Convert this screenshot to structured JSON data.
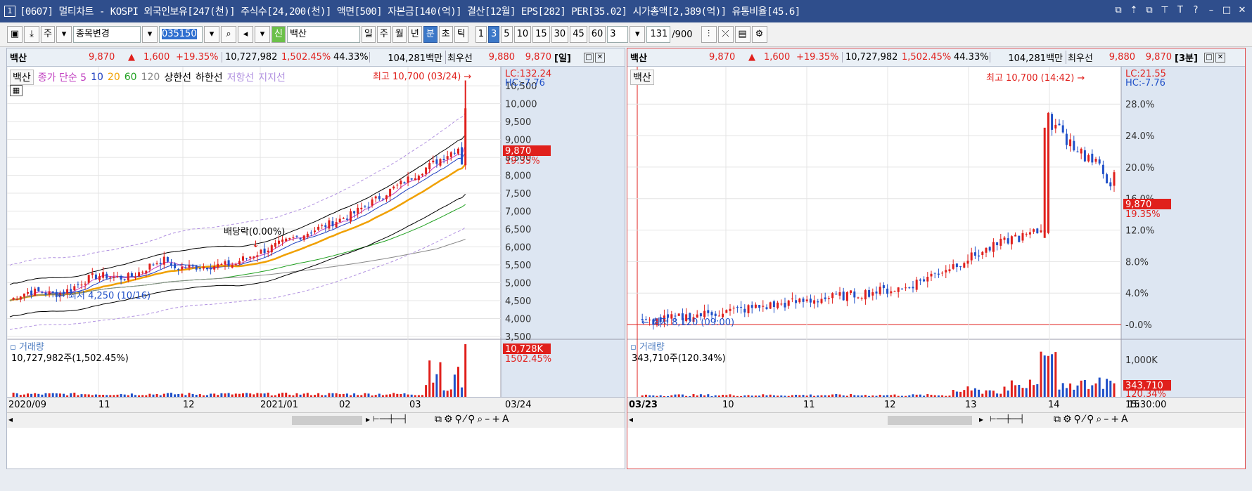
{
  "window": {
    "num": "1",
    "title": "[0607] 멀티차트 - KOSPI 외국인보유[247(천)] 주식수[24,200(천)] 액면[500] 자본금[140(억)] 결산[12월] EPS[282] PER[35.02] 시가총액[2,389(억)] 유통비율[45.6]",
    "controls": [
      "⧉",
      "⇡",
      "⧉",
      "⊤",
      "T",
      "?",
      "–",
      "□",
      "✕"
    ]
  },
  "toolbar": {
    "jong_label": "주",
    "change_label": "종목변경",
    "code": "035150",
    "stock_prefix": "신",
    "stock_name": "백산",
    "periods": [
      "일",
      "주",
      "월",
      "년",
      "분",
      "초",
      "틱"
    ],
    "period_selected": "분",
    "nums": [
      "1",
      "3",
      "5",
      "10",
      "15",
      "30",
      "45",
      "60"
    ],
    "num_selected": "3",
    "count_value": "3",
    "view_count": "131",
    "view_total": "/900"
  },
  "left": {
    "info": {
      "name": "백산",
      "price": "9,870",
      "arrow": "▲",
      "change": "1,600",
      "pct": "+19.35%",
      "volume": "10,727,982",
      "vol_pct": "1,502.45%",
      "ratio": "44.33%",
      "amount": "104,281백만",
      "best_label": "최우선",
      "ask": "9,880",
      "bid": "9,870",
      "period": "[일]"
    },
    "legend": {
      "name": "백산",
      "items": [
        "종가 단순 5",
        "10",
        "20",
        "60",
        "120",
        "상한선",
        "하한선",
        "저항선",
        "지지선"
      ],
      "colors": [
        "#c040c0",
        "#2040c0",
        "#f0a000",
        "#20a020",
        "#888888",
        "#000000",
        "#000000",
        "#b090e0",
        "#b090e0"
      ]
    },
    "y_ticks": [
      "10,500",
      "10,000",
      "9,500",
      "9,000",
      "8,500",
      "8,000",
      "7,500",
      "7,000",
      "6,500",
      "6,000",
      "5,500",
      "5,000",
      "4,500",
      "4,000",
      "3,500"
    ],
    "lc": "LC:132.24",
    "hc": "HC:-7.76",
    "price_tag": "9,870",
    "pct_tag": "19.35%",
    "high_label": "최고 10,700 (03/24)",
    "low_label": "최저 4,250 (10/16)",
    "dividend_label": "배당락(0.00%)",
    "vol_title": "거래량",
    "vol_text": "10,727,982주(1,502.45%)",
    "vol_tag": "10,728K",
    "vol_pct_tag": "1502.45%",
    "x_labels": [
      "2020/09",
      "11",
      "12",
      "2021/01",
      "02",
      "03"
    ],
    "x_end": "03/24"
  },
  "right": {
    "info": {
      "name": "백산",
      "price": "9,870",
      "arrow": "▲",
      "change": "1,600",
      "pct": "+19.35%",
      "volume": "10,727,982",
      "vol_pct": "1,502.45%",
      "ratio": "44.33%",
      "amount": "104,281백만",
      "best_label": "최우선",
      "ask": "9,880",
      "bid": "9,870",
      "period": "[3분]"
    },
    "legend_name": "백산",
    "y_ticks": [
      "28.0%",
      "24.0%",
      "20.0%",
      "16.0%",
      "12.0%",
      "8.0%",
      "4.0%",
      "-0.0%"
    ],
    "lc": "LC:21.55",
    "hc": "HC:-7.76",
    "price_tag": "9,870",
    "pct_tag": "19.35%",
    "high_label": "최고 10,700 (14:42)",
    "low_label": "최저 8,120 (09:00)",
    "vol_title": "거래량",
    "vol_text": "343,710주(120.34%)",
    "vol_tick": "1,000K",
    "vol_tag": "343,710",
    "vol_pct_tag": "120.34%",
    "x_labels": [
      "03/23",
      "10",
      "11",
      "12",
      "13",
      "14",
      "15"
    ],
    "x_end": "15:30:00"
  },
  "colors": {
    "up": "#e0201c",
    "down": "#2050c8",
    "accent": "#3c78c8"
  },
  "chart_data": [
    {
      "type": "candlestick",
      "title": "백산 [일]",
      "ylim": [
        3500,
        10700
      ],
      "series": [
        {
          "name": "종가 단순 5"
        },
        {
          "name": "10"
        },
        {
          "name": "20"
        },
        {
          "name": "60"
        },
        {
          "name": "120"
        }
      ],
      "last": 9870,
      "high": 10700,
      "low": 4250
    },
    {
      "type": "candlestick",
      "title": "백산 [3분]",
      "ylim": [
        -0.8,
        29
      ],
      "y_unit": "%",
      "last_pct": 19.35,
      "high": 10700,
      "low": 8120
    }
  ]
}
